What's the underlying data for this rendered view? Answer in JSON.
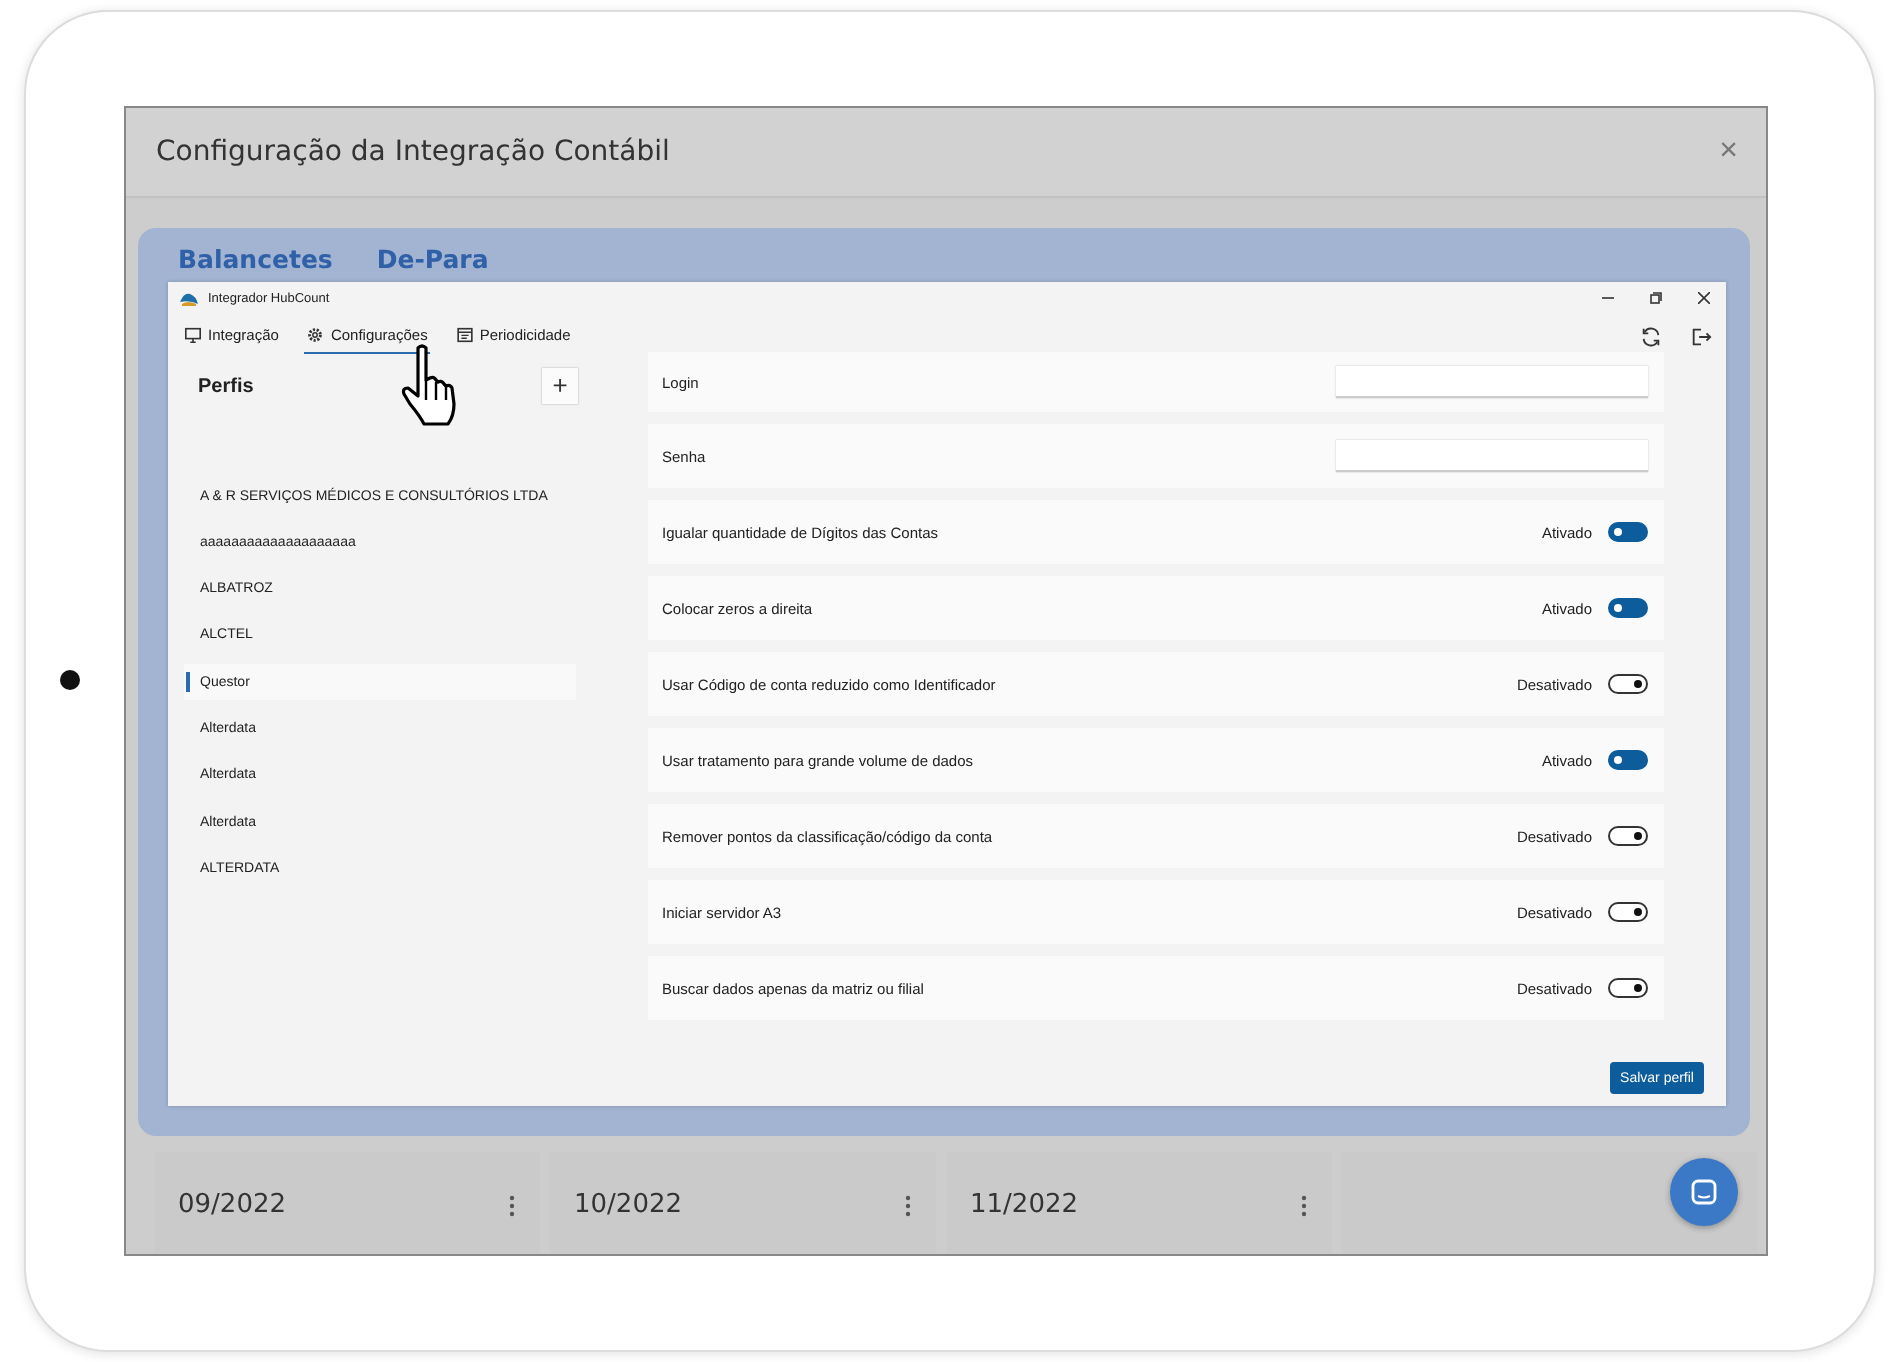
{
  "dialog": {
    "title": "Configuração da Integração Contábil",
    "close": "×"
  },
  "tabs": [
    {
      "label": "Balancetes"
    },
    {
      "label": "De-Para"
    }
  ],
  "app_window": {
    "title": "Integrador HubCount",
    "nav": [
      {
        "label": "Integração",
        "kind": "monitor",
        "selected": false
      },
      {
        "label": "Configurações",
        "kind": "gear",
        "selected": true
      },
      {
        "label": "Periodicidade",
        "kind": "calendar",
        "selected": false
      }
    ]
  },
  "profiles": {
    "title": "Perfis",
    "add": "+",
    "items": [
      {
        "label": "A & R SERVIÇOS MÉDICOS E CONSULTÓRIOS LTDA",
        "selected": false
      },
      {
        "label": "aaaaaaaaaaaaaaaaaaaa",
        "selected": false
      },
      {
        "label": "ALBATROZ",
        "selected": false
      },
      {
        "label": "ALCTEL",
        "selected": false
      },
      {
        "label": "Questor",
        "selected": true
      },
      {
        "label": "Alterdata",
        "selected": false
      },
      {
        "label": "Alterdata",
        "selected": false
      },
      {
        "label": "Alterdata",
        "selected": false
      },
      {
        "label": "ALTERDATA",
        "selected": false
      }
    ]
  },
  "settings": [
    {
      "kind": "input",
      "label": "Login"
    },
    {
      "kind": "input",
      "label": "Senha"
    },
    {
      "kind": "toggle",
      "label": "Igualar quantidade de Dígitos das Contas",
      "status": "Ativado",
      "on": true
    },
    {
      "kind": "toggle",
      "label": "Colocar zeros a direita",
      "status": "Ativado",
      "on": true
    },
    {
      "kind": "toggle",
      "label": "Usar Código de conta reduzido como Identificador",
      "status": "Desativado",
      "on": false
    },
    {
      "kind": "toggle",
      "label": "Usar tratamento para grande volume de dados",
      "status": "Ativado",
      "on": true
    },
    {
      "kind": "toggle",
      "label": "Remover pontos da classificação/código da conta",
      "status": "Desativado",
      "on": false
    },
    {
      "kind": "toggle",
      "label": "Iniciar servidor A3",
      "status": "Desativado",
      "on": false
    },
    {
      "kind": "toggle",
      "label": "Buscar dados apenas da matriz ou filial",
      "status": "Desativado",
      "on": false
    }
  ],
  "save_button": "Salvar perfil",
  "periods": [
    {
      "label": "09/2022"
    },
    {
      "label": "10/2022"
    },
    {
      "label": "11/2022"
    }
  ]
}
